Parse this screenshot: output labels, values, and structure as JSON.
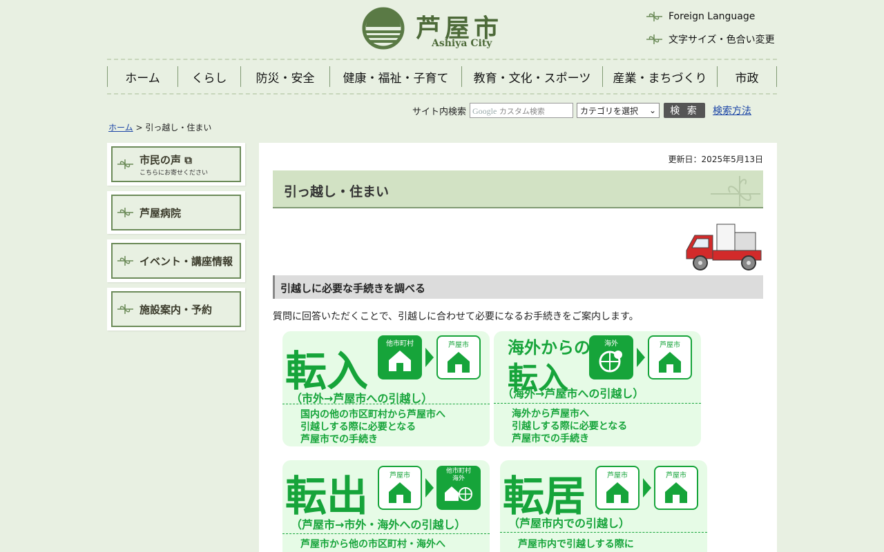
{
  "header": {
    "logo_text": "芦屋市",
    "logo_sub": "Ashiya City",
    "util_links": [
      "Foreign Language",
      "文字サイズ・色合い変更"
    ]
  },
  "nav": [
    "ホーム",
    "くらし",
    "防災・安全",
    "健康・福祉・子育て",
    "教育・文化・スポーツ",
    "産業・まちづくり",
    "市政"
  ],
  "search": {
    "label": "サイト内検索",
    "placeholder": "カスタム検索",
    "category": "カテゴリを選択",
    "button": "検 索",
    "help_link": "検索方法"
  },
  "breadcrumb": {
    "home": "ホーム",
    "sep": " > ",
    "current": "引っ越し・住まい"
  },
  "sidebar": [
    {
      "label": "市民の声",
      "sub": "こちらにお寄せください"
    },
    {
      "label": "芦屋病院"
    },
    {
      "label": "イベント・講座情報"
    },
    {
      "label": "施設案内・予約"
    }
  ],
  "main": {
    "updated": "更新日：2025年5月13日",
    "title": "引っ越し・住まい",
    "section_title": "引越しに必要な手続きを調べる",
    "description": "質問に回答いただくことで、引越しに合わせて必要になるお手続きをご案内します。",
    "cards": [
      {
        "title": "転入",
        "from": "他市町村",
        "to": "芦屋市",
        "paren": "（市外→芦屋市への引越し）",
        "note": "国内の他の市区町村から芦屋市へ\n引越しする際に必要となる\n芦屋市での手続き"
      },
      {
        "title1": "海外からの",
        "title2": "転入",
        "from": "海外",
        "to": "芦屋市",
        "paren": "（海外→芦屋市への引越し）",
        "note": "海外から芦屋市へ\n引越しする際に必要となる\n芦屋市での手続き"
      },
      {
        "title": "転出",
        "from": "芦屋市",
        "to1": "他市町村",
        "to2": "海外",
        "paren": "（芦屋市→市外・海外への引越し）",
        "note": "芦屋市から他の市区町村・海外へ"
      },
      {
        "title": "転居",
        "from": "芦屋市",
        "to": "芦屋市",
        "paren": "（芦屋市内での引越し）",
        "note": "芦屋市内で引越しする際に"
      }
    ]
  },
  "colors": {
    "background": "#e8f0e2",
    "brand_green": "#4d6a39",
    "card_green": "#16a43a"
  }
}
